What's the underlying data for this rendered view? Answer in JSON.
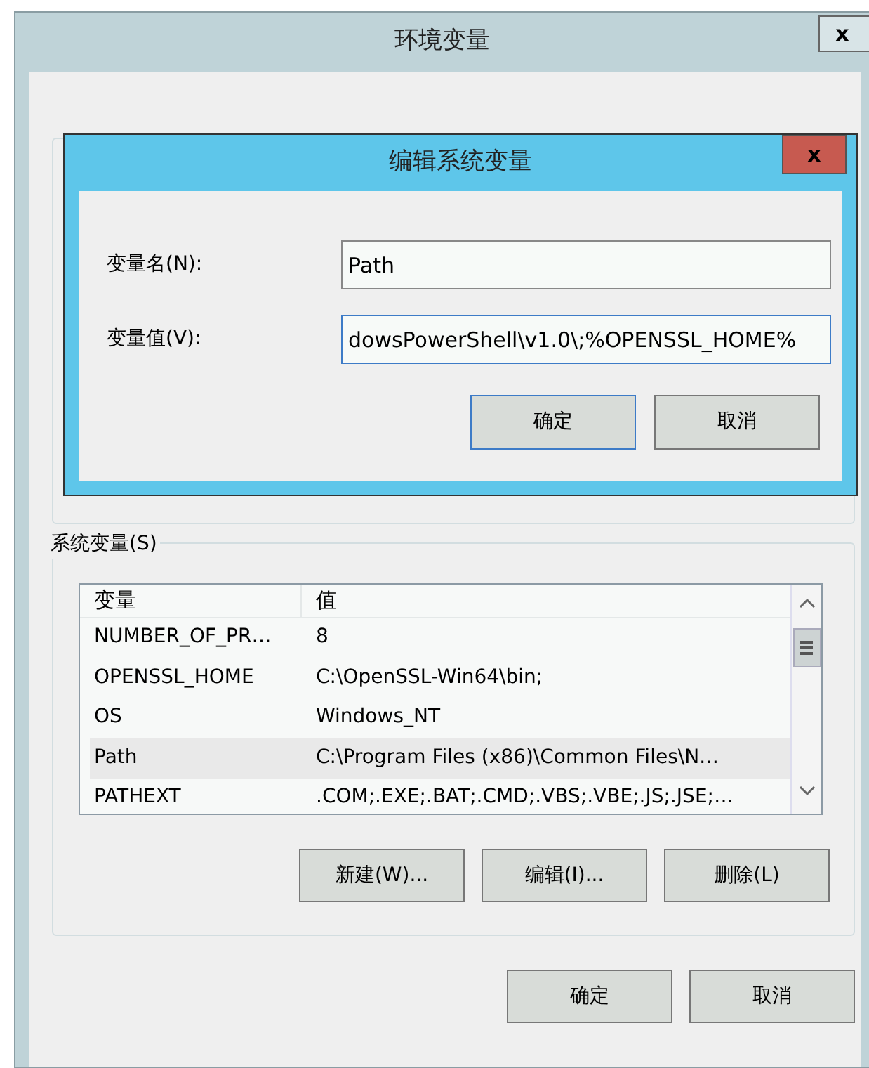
{
  "window": {
    "title": "环境变量",
    "close": "x"
  },
  "edit_dialog": {
    "title": "编辑系统变量",
    "close": "x",
    "fields": [
      {
        "label": "变量名(N):",
        "value": "Path",
        "focused": false
      },
      {
        "label": "变量值(V):",
        "value": "dowsPowerShell\\v1.0\\;%OPENSSL_HOME%",
        "focused": true
      }
    ],
    "buttons": [
      {
        "label": "确定",
        "default": true
      },
      {
        "label": "取消",
        "default": false
      }
    ]
  },
  "system_variables": {
    "label": "系统变量(S)",
    "columns": [
      "变量",
      "值"
    ],
    "rows": [
      {
        "name": "NUMBER_OF_PR…",
        "value": "8",
        "selected": false
      },
      {
        "name": "OPENSSL_HOME",
        "value": "C:\\OpenSSL-Win64\\bin;",
        "selected": false
      },
      {
        "name": "OS",
        "value": "Windows_NT",
        "selected": false
      },
      {
        "name": "Path",
        "value": "C:\\Program Files (x86)\\Common Files\\N…",
        "selected": true
      },
      {
        "name": "PATHEXT",
        "value": ".COM;.EXE;.BAT;.CMD;.VBS;.VBE;.JS;.JSE;…",
        "selected": false
      }
    ],
    "buttons": [
      "新建(W)...",
      "编辑(I)...",
      "删除(L)"
    ]
  },
  "buttons": [
    {
      "label": "确定"
    },
    {
      "label": "取消"
    }
  ]
}
